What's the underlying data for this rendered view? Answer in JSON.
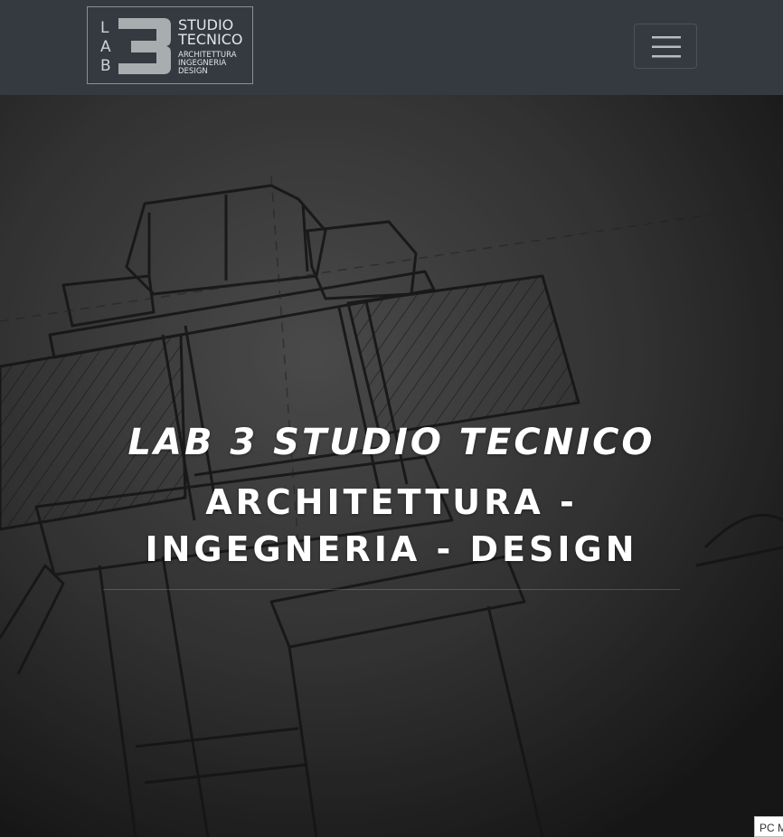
{
  "navbar": {
    "logo": {
      "mark_text": "LAB",
      "mark_digit": "3",
      "line1": "STUDIO",
      "line2": "TECNICO",
      "line3": "ARCHITETTURA",
      "line4": "INGEGNERIA",
      "line5": "DESIGN"
    },
    "menu_icon": "hamburger-menu-icon",
    "background_color": "#343a40"
  },
  "hero": {
    "title": "LAB 3 STUDIO TECNICO",
    "subtitle": "ARCHITETTURA - INGEGNERIA - DESIGN",
    "background": "technical-drawing-bolt-photo"
  },
  "corner_badge": {
    "text": "PC M"
  }
}
